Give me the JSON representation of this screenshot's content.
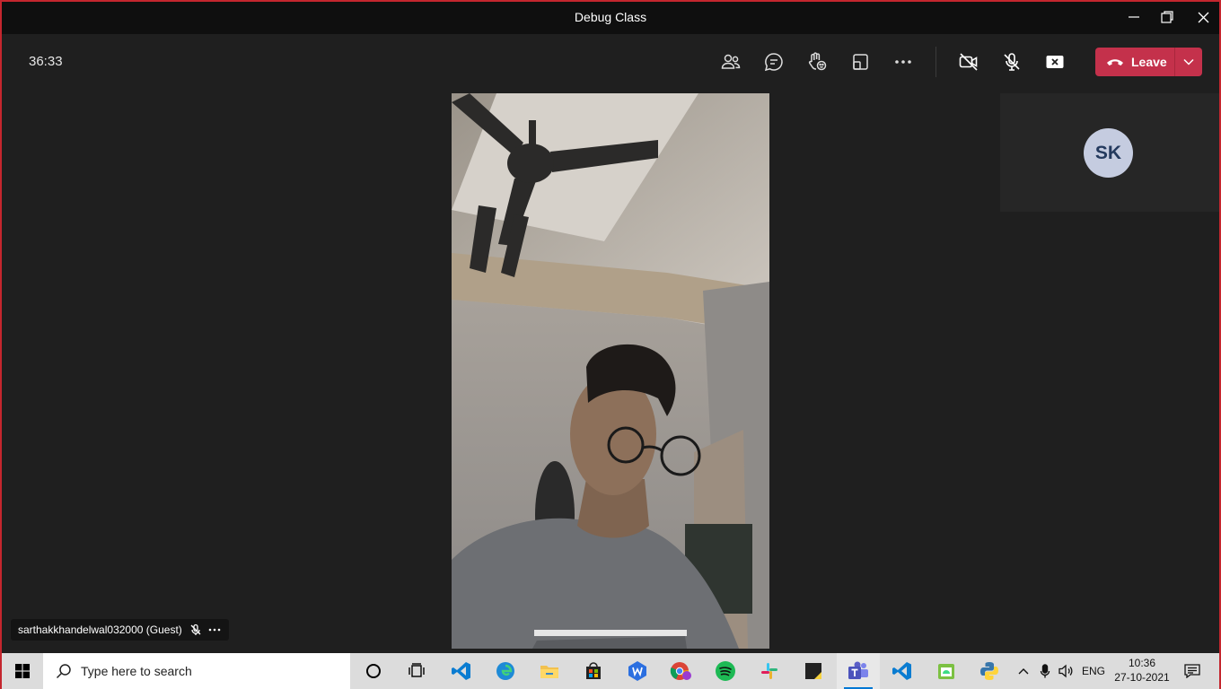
{
  "window": {
    "title": "Debug Class"
  },
  "toolbar": {
    "timer": "36:33",
    "leave_label": "Leave"
  },
  "stage": {
    "participant_initials": "SK",
    "nametag": "sarthakkhandelwal032000 (Guest)"
  },
  "taskbar": {
    "search_placeholder": "Type here to search",
    "language": "ENG",
    "time": "10:36",
    "date": "27-10-2021"
  },
  "colors": {
    "leave": "#c4314b",
    "frame_border": "#c4262e",
    "avatar_bg": "#c5cce0",
    "avatar_fg": "#243a5e",
    "teams": "#5b5fc7",
    "vscode": "#0a7cd1"
  },
  "icons": [
    "participants-icon",
    "chat-icon",
    "reactions-icon",
    "share-tray-icon",
    "more-icon",
    "camera-off-icon",
    "mic-off-icon",
    "share-stop-icon",
    "phone-icon"
  ]
}
